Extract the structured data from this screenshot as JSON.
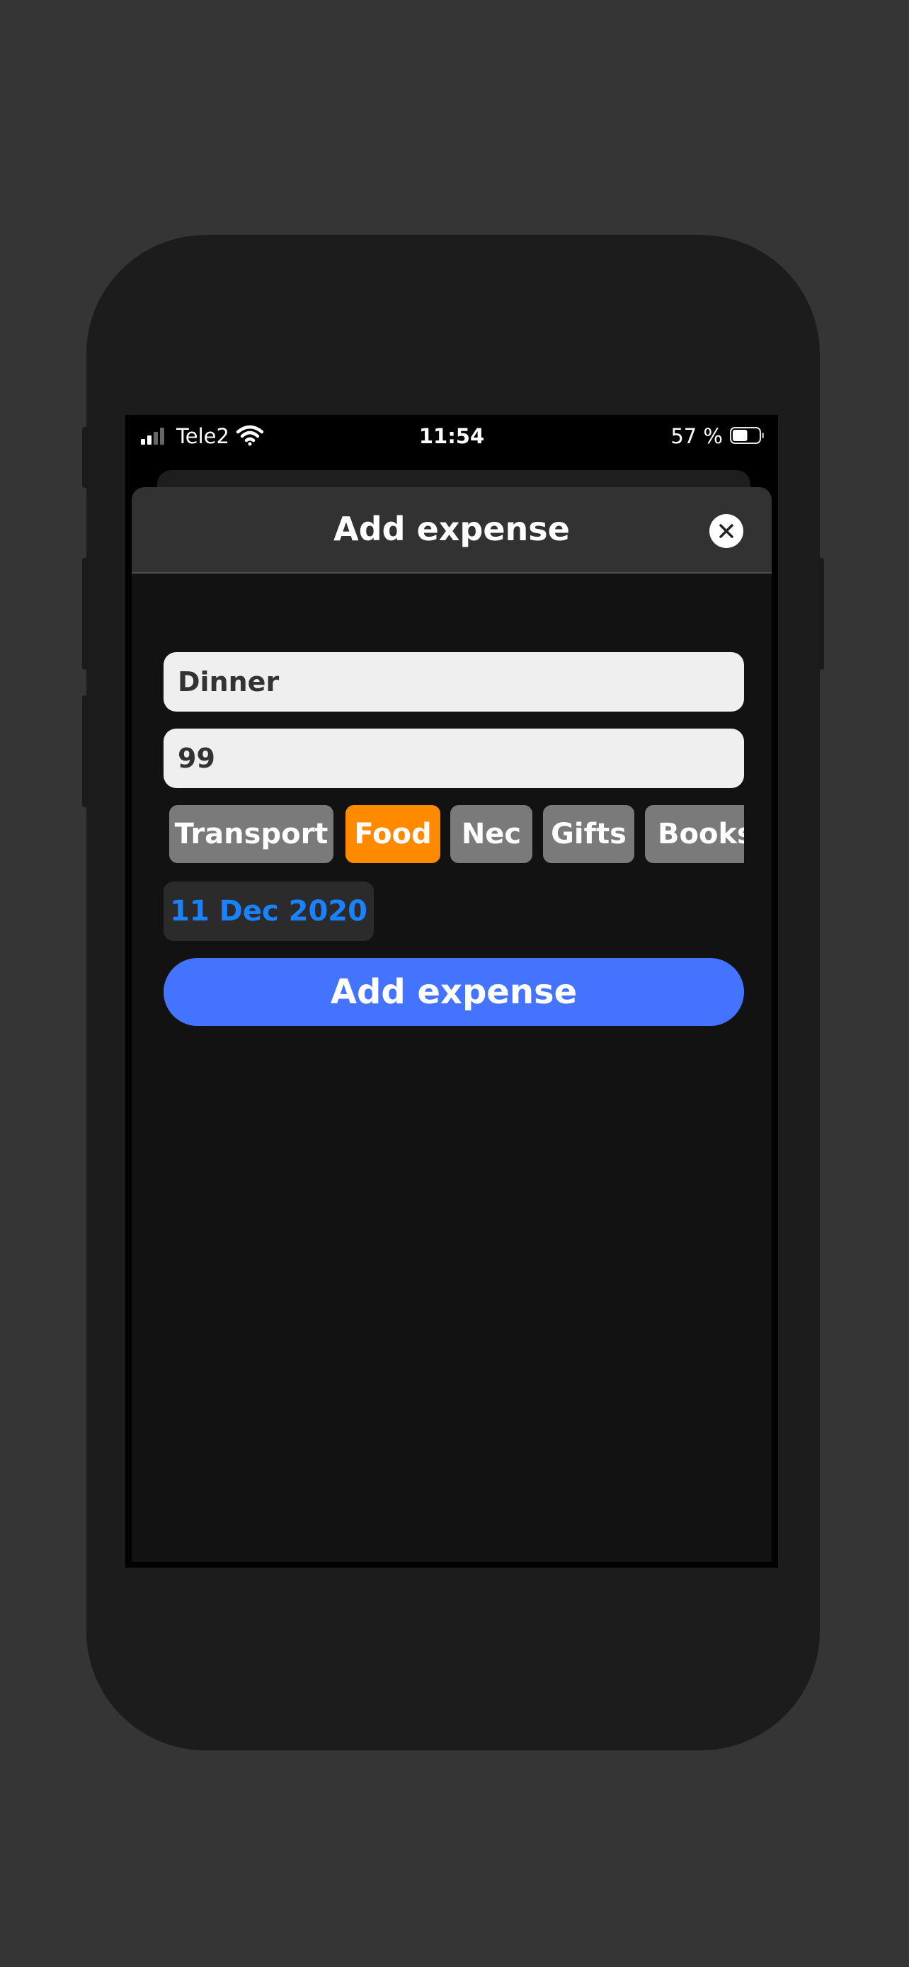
{
  "status_bar": {
    "carrier": "Tele2",
    "time": "11:54",
    "battery_percent": "57 %",
    "battery_level": 0.57
  },
  "sheet": {
    "title": "Add expense",
    "close_icon": "close-icon"
  },
  "form": {
    "name_value": "Dinner",
    "amount_value": "99",
    "categories": [
      {
        "label": "Transport",
        "selected": false
      },
      {
        "label": "Food",
        "selected": true
      },
      {
        "label": "Nec",
        "selected": false
      },
      {
        "label": "Gifts",
        "selected": false
      },
      {
        "label": "Books",
        "selected": false
      }
    ],
    "date": "11 Dec 2020",
    "submit_label": "Add expense"
  },
  "colors": {
    "accent_blue": "#4473ff",
    "date_blue": "#1a82ff",
    "selected_category": "#ff8a00",
    "category_default": "#7a7a7a"
  }
}
